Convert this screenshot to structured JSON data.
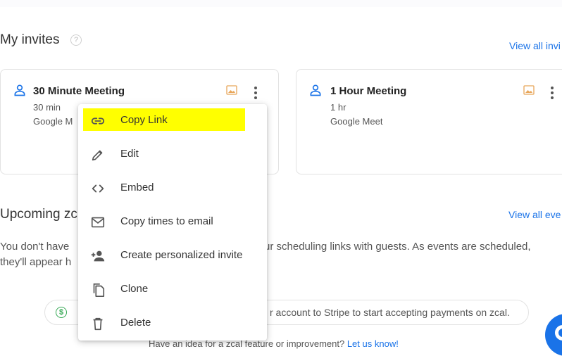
{
  "invites": {
    "title": "My invites",
    "help_glyph": "?",
    "view_all": "View all invi",
    "cards": [
      {
        "title": "30 Minute Meeting",
        "duration": "30 min",
        "location": "Google M"
      },
      {
        "title": "1 Hour Meeting",
        "duration": "1 hr",
        "location": "Google Meet"
      }
    ]
  },
  "upcoming": {
    "title": "Upcoming zc",
    "view_all": "View all eve",
    "desc_line1_start": "You don't have",
    "desc_line1_end": "ur scheduling links with guests. As events are scheduled,",
    "desc_line2": "they'll appear h"
  },
  "stripe": {
    "icon_glyph": "$",
    "text": "r account to Stripe to start accepting payments on zcal."
  },
  "feedback": {
    "text": "Have an idea for a zcal feature or improvement?",
    "link": "Let us know!"
  },
  "menu": {
    "items": [
      {
        "label": "Copy Link",
        "icon": "link-icon"
      },
      {
        "label": "Edit",
        "icon": "pencil-icon"
      },
      {
        "label": "Embed",
        "icon": "code-icon"
      },
      {
        "label": "Copy times to email",
        "icon": "mail-icon"
      },
      {
        "label": "Create personalized invite",
        "icon": "person-add-icon"
      },
      {
        "label": "Clone",
        "icon": "copy-icon"
      },
      {
        "label": "Delete",
        "icon": "trash-icon"
      }
    ]
  },
  "colors": {
    "accent": "#1a73e8",
    "highlight": "#ffff00",
    "stripe_green": "#34a853",
    "image_icon": "#e8a65a"
  }
}
